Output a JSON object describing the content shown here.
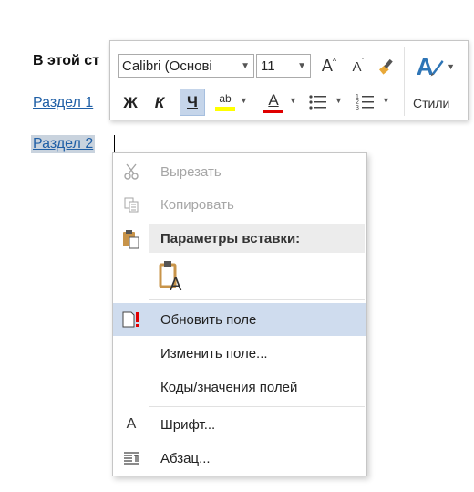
{
  "document": {
    "line1": "В этой ст",
    "link1": "Раздел 1",
    "link2": "Раздел 2"
  },
  "mini_toolbar": {
    "font_name": "Calibri (Основі",
    "font_size": "11",
    "grow_label": "A",
    "shrink_label": "A",
    "bold": "Ж",
    "italic": "К",
    "underline": "Ч",
    "highlight_label": "ab",
    "font_color_label": "A",
    "styles_label": "Стили",
    "colors": {
      "highlight": "#ffff00",
      "font_color": "#e00000",
      "styles": "#2e75b6"
    }
  },
  "context_menu": {
    "items": [
      {
        "label": "Вырезать",
        "icon": "scissors-icon",
        "disabled": true
      },
      {
        "label": "Копировать",
        "icon": "copy-icon",
        "disabled": true
      },
      {
        "label": "Параметры вставки:",
        "icon": "paste-icon"
      },
      {
        "label": "Обновить поле",
        "icon": "update-field-icon",
        "highlighted": true
      },
      {
        "label": "Изменить поле...",
        "icon": ""
      },
      {
        "label": "Коды/значения полей",
        "icon": ""
      },
      {
        "label": "Шрифт...",
        "icon": "font-icon"
      },
      {
        "label": "Абзац...",
        "icon": "paragraph-icon"
      }
    ],
    "paste_option_icon": "paste-keep-text-icon",
    "font_icon_glyph": "A"
  }
}
